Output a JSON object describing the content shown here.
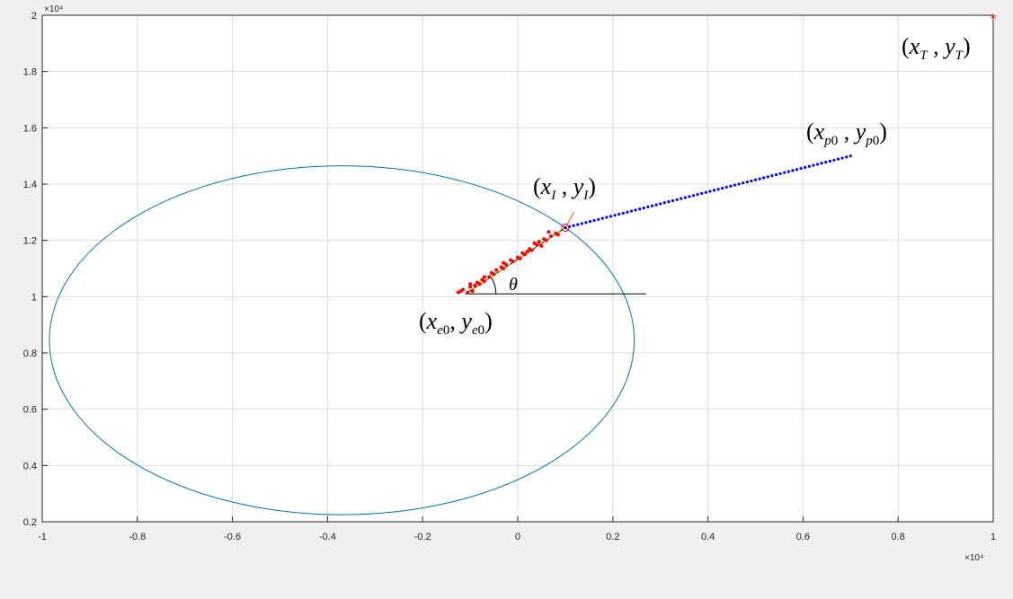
{
  "chart_data": {
    "type": "scatter",
    "title": "",
    "xlabel": "",
    "ylabel": "",
    "xlim": [
      -10000,
      10000
    ],
    "ylim": [
      2000,
      20000
    ],
    "grid": true,
    "x_ticks": [
      -10000,
      -8000,
      -6000,
      -4000,
      -2000,
      0,
      2000,
      4000,
      6000,
      8000,
      10000
    ],
    "x_tick_labels": [
      "-1",
      "-0.8",
      "-0.6",
      "-0.4",
      "-0.2",
      "0",
      "0.2",
      "0.4",
      "0.6",
      "0.8",
      "1"
    ],
    "y_ticks": [
      2000,
      4000,
      6000,
      8000,
      10000,
      12000,
      14000,
      16000,
      18000,
      20000
    ],
    "y_tick_labels": [
      "0.2",
      "0.4",
      "0.6",
      "0.8",
      "1",
      "1.2",
      "1.4",
      "1.6",
      "1.8",
      "2"
    ],
    "x_exponent_label": "×10⁴",
    "y_exponent_label": "×10⁴",
    "ellipse": {
      "cx": -3700,
      "cy": 8450,
      "rx": 6150,
      "ry": 6200,
      "color": "#0072bd"
    },
    "pursuer_path": {
      "from": [
        7000,
        15000
      ],
      "to": [
        1000,
        12450
      ],
      "n_points": 70,
      "color": "#0000ff"
    },
    "interception_point": [
      1000,
      12450
    ],
    "target_point": [
      10000,
      19900
    ],
    "target_color": "#ff0000",
    "evader_start": [
      -1100,
      10100
    ],
    "reference_line": {
      "from": [
        -1100,
        10100
      ],
      "to": [
        2700,
        10100
      ]
    },
    "evader_path_color": "#ff0000",
    "evader_trend_color": "#77ac30",
    "evader_points": [
      [
        -1200,
        10200
      ],
      [
        -1150,
        10250
      ],
      [
        -1050,
        10150
      ],
      [
        -1000,
        10350
      ],
      [
        -950,
        10200
      ],
      [
        -900,
        10400
      ],
      [
        -850,
        10500
      ],
      [
        -800,
        10450
      ],
      [
        -750,
        10600
      ],
      [
        -700,
        10550
      ],
      [
        -600,
        10700
      ],
      [
        -550,
        10850
      ],
      [
        -500,
        10800
      ],
      [
        -450,
        10950
      ],
      [
        -350,
        11050
      ],
      [
        -300,
        11200
      ],
      [
        -250,
        11150
      ],
      [
        -150,
        11300
      ],
      [
        -100,
        11250
      ],
      [
        0,
        11400
      ],
      [
        50,
        11350
      ],
      [
        100,
        11550
      ],
      [
        200,
        11600
      ],
      [
        250,
        11700
      ],
      [
        300,
        11650
      ],
      [
        400,
        11850
      ],
      [
        450,
        11950
      ],
      [
        500,
        11800
      ],
      [
        550,
        12050
      ],
      [
        600,
        12000
      ],
      [
        700,
        12150
      ],
      [
        800,
        12250
      ],
      [
        850,
        12200
      ],
      [
        -1000,
        10450
      ],
      [
        -700,
        10700
      ],
      [
        -300,
        11000
      ],
      [
        150,
        11500
      ],
      [
        350,
        11900
      ],
      [
        650,
        12300
      ],
      [
        -1250,
        10150
      ]
    ]
  },
  "annotations": {
    "target_label": "(x_T , y_T)",
    "pursuer_label": "(x_p0 , y_p0)",
    "intercept_label": "(x_I , y_I)",
    "evader_label": "(x_e0 , y_e0)",
    "angle_label": "θ"
  }
}
